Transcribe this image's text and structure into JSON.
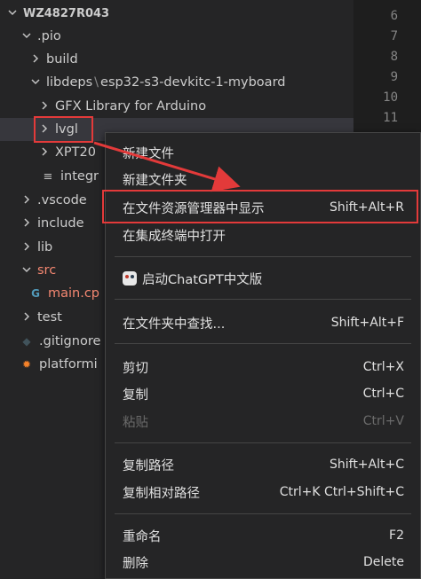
{
  "explorer": {
    "root": "WZ4827R043",
    "items": [
      {
        "label": ".pio"
      },
      {
        "label": "build"
      },
      {
        "label": "libdeps"
      },
      {
        "label": "esp32-s3-devkitc-1-myboard"
      },
      {
        "label": "GFX Library for Arduino"
      },
      {
        "label": "lvgl"
      },
      {
        "label": "XPT20"
      },
      {
        "label": "integr"
      },
      {
        "label": ".vscode"
      },
      {
        "label": "include"
      },
      {
        "label": "lib"
      },
      {
        "label": "src"
      },
      {
        "label": "main.cp"
      },
      {
        "label": "test"
      },
      {
        "label": ".gitignore"
      },
      {
        "label": "platformi"
      }
    ]
  },
  "gutter": {
    "line_numbers": [
      "6",
      "7",
      "8",
      "9",
      "10",
      "11"
    ]
  },
  "context_menu": {
    "items": [
      {
        "label": "新建文件",
        "shortcut": ""
      },
      {
        "label": "新建文件夹",
        "shortcut": ""
      },
      {
        "label": "在文件资源管理器中显示",
        "shortcut": "Shift+Alt+R"
      },
      {
        "label": "在集成终端中打开",
        "shortcut": ""
      },
      {
        "label": "启动ChatGPT中文版",
        "shortcut": ""
      },
      {
        "label": "在文件夹中查找...",
        "shortcut": "Shift+Alt+F"
      },
      {
        "label": "剪切",
        "shortcut": "Ctrl+X"
      },
      {
        "label": "复制",
        "shortcut": "Ctrl+C"
      },
      {
        "label": "粘贴",
        "shortcut": "Ctrl+V"
      },
      {
        "label": "复制路径",
        "shortcut": "Shift+Alt+C"
      },
      {
        "label": "复制相对路径",
        "shortcut": "Ctrl+K Ctrl+Shift+C"
      },
      {
        "label": "重命名",
        "shortcut": "F2"
      },
      {
        "label": "删除",
        "shortcut": "Delete"
      }
    ]
  },
  "colors": {
    "annotation_red": "#e33a3a",
    "background": "#1e1e1e",
    "sidebar": "#252526"
  }
}
